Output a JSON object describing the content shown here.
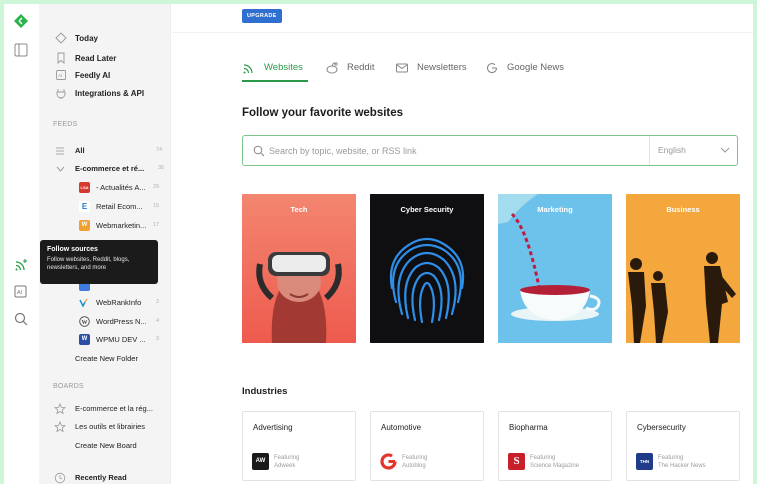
{
  "sidebar": {
    "nav": [
      {
        "label": "Today",
        "icon": "today-icon"
      },
      {
        "label": "Read Later",
        "icon": "bookmark-icon"
      },
      {
        "label": "Feedly AI",
        "icon": "ai-icon"
      },
      {
        "label": "Integrations & API",
        "icon": "plug-icon"
      }
    ],
    "feeds_label": "FEEDS",
    "all": {
      "label": "All",
      "count": "74"
    },
    "folder": {
      "label": "E-commerce et ré...",
      "count": "35"
    },
    "feeds": [
      {
        "label": "- Actualités A...",
        "count": "29",
        "color": "#d63a2f",
        "glyph": "LSA"
      },
      {
        "label": "Retail Ecom...",
        "count": "15",
        "color": "#ffffff",
        "glyph": "E"
      },
      {
        "label": "Webmarketin...",
        "count": "17",
        "color": "#f0a030",
        "glyph": "W"
      }
    ],
    "feeds_lower": [
      {
        "label": "WebRankInfo",
        "count": "2",
        "color": "#ffffff",
        "glyph": "W"
      },
      {
        "label": "WordPress N...",
        "count": "4",
        "color": "#ffffff",
        "glyph": "W"
      },
      {
        "label": "WPMU DEV ...",
        "count": "3",
        "color": "#2c4fa3",
        "glyph": "W"
      }
    ],
    "create_folder": "Create New Folder",
    "boards_label": "BOARDS",
    "boards": [
      {
        "label": "E-commerce et la rég..."
      },
      {
        "label": "Les outils et librairies"
      }
    ],
    "create_board": "Create New Board",
    "recently_read": "Recently Read"
  },
  "tooltip": {
    "title": "Follow sources",
    "body": "Follow websites, Reddit, blogs, newsletters, and more"
  },
  "main": {
    "upgrade_label": "UPGRADE",
    "tabs": [
      {
        "label": "Websites",
        "icon": "rss-icon",
        "active": true
      },
      {
        "label": "Reddit",
        "icon": "reddit-icon",
        "active": false
      },
      {
        "label": "Newsletters",
        "icon": "mail-icon",
        "active": false
      },
      {
        "label": "Google News",
        "icon": "google-icon",
        "active": false
      }
    ],
    "heading": "Follow your favorite websites",
    "search": {
      "placeholder": "Search by topic, website, or RSS link",
      "value": ""
    },
    "language": "English",
    "categories": [
      {
        "label": "Tech",
        "color": "#f2665b"
      },
      {
        "label": "Cyber Security",
        "color": "#0f0f12"
      },
      {
        "label": "Marketing",
        "color": "#6cc2ea"
      },
      {
        "label": "Business",
        "color": "#f3a73c"
      }
    ],
    "industries_title": "Industries",
    "industries": [
      {
        "title": "Advertising",
        "featuring": "Featuring",
        "source": "Adweek",
        "logo": "AW",
        "color": "#1a1a1a"
      },
      {
        "title": "Automotive",
        "featuring": "Featuring",
        "source": "Autoblog",
        "logo": "",
        "color": "#e2352c"
      },
      {
        "title": "Biopharma",
        "featuring": "Featuring",
        "source": "Science Magazine",
        "logo": "S",
        "color": "#c8202b"
      },
      {
        "title": "Cybersecurity",
        "featuring": "Featuring",
        "source": "The Hacker News",
        "logo": "THN",
        "color": "#1f3b8a"
      }
    ]
  },
  "colors": {
    "accent": "#2a9a4a",
    "upgrade": "#2f6fcf",
    "page_bg": "#cdf5d8"
  }
}
